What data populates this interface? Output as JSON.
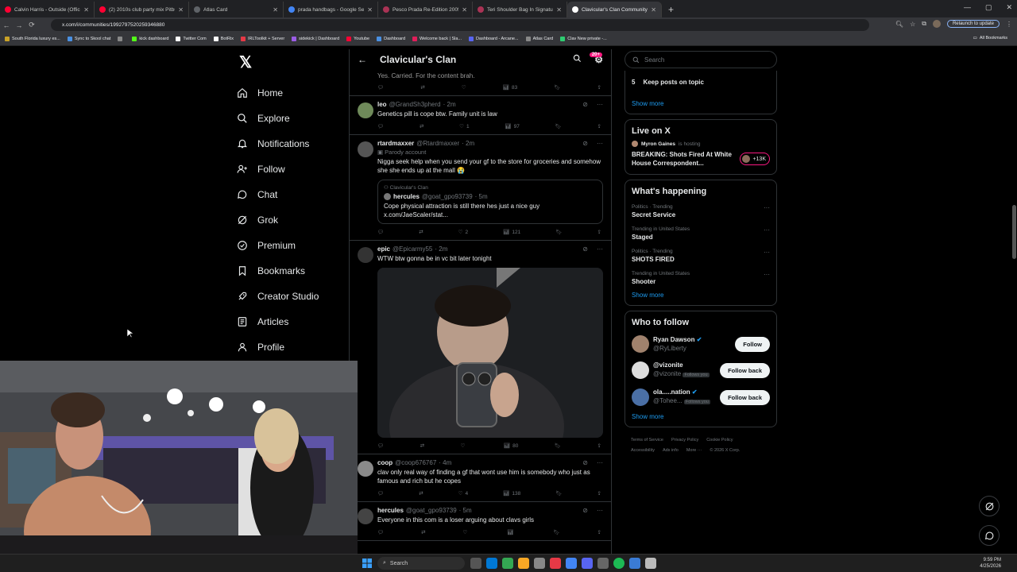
{
  "browser": {
    "tabs": [
      {
        "title": "Calvin Harris - Outside (Official",
        "color": "#ff0033",
        "active": false
      },
      {
        "title": "(2) 2010s club party mix Pitbull",
        "color": "#ff0033",
        "active": false
      },
      {
        "title": "Atlas Card",
        "color": "#5f6368",
        "active": false
      },
      {
        "title": "prada handbags - Google Search",
        "color": "#4285f4",
        "active": false
      },
      {
        "title": "Pesco Prada Re-Edition 2005 R",
        "color": "#aa3355",
        "active": false
      },
      {
        "title": "Teri Shoulder Bag In Signature",
        "color": "#aa3355",
        "active": false
      },
      {
        "title": "Clavicular's Clan Community / X",
        "color": "#ffffff",
        "active": true
      }
    ],
    "url": "x.com/i/communities/1992797520259346880",
    "relaunch_label": "Relaunch to update",
    "bookmarks": [
      {
        "label": "South Florida luxury es...",
        "color": "#c9a227"
      },
      {
        "label": "Sync to Skool chat",
        "color": "#4a90e2"
      },
      {
        "label": "",
        "color": "#888888"
      },
      {
        "label": "kick dashboard",
        "color": "#53fc18"
      },
      {
        "label": "Twitter Com",
        "color": "#ffffff"
      },
      {
        "label": "BotRix",
        "color": "#ffffff"
      },
      {
        "label": "IRLToolkit + Server",
        "color": "#e63946"
      },
      {
        "label": "sidekick | Dashboard",
        "color": "#9b5de5"
      },
      {
        "label": "Youtube",
        "color": "#ff0033"
      },
      {
        "label": "Dashboard",
        "color": "#4a90e2"
      },
      {
        "label": "Welcome back | Sla...",
        "color": "#e01e5a"
      },
      {
        "label": "Dashboard - Arcane...",
        "color": "#5865f2"
      },
      {
        "label": "Atlas Card",
        "color": "#888888"
      },
      {
        "label": "Clav New private -...",
        "color": "#2ecc71"
      }
    ],
    "all_bookmarks": "All Bookmarks"
  },
  "nav": {
    "logo": "𝕏",
    "items": [
      {
        "label": "Home",
        "icon": "home-icon"
      },
      {
        "label": "Explore",
        "icon": "search-icon"
      },
      {
        "label": "Notifications",
        "icon": "bell-icon"
      },
      {
        "label": "Follow",
        "icon": "add-person-icon"
      },
      {
        "label": "Chat",
        "icon": "chat-icon"
      },
      {
        "label": "Grok",
        "icon": "grok-icon"
      },
      {
        "label": "Premium",
        "icon": "premium-icon"
      },
      {
        "label": "Bookmarks",
        "icon": "bookmark-icon"
      },
      {
        "label": "Creator Studio",
        "icon": "rocket-icon"
      },
      {
        "label": "Articles",
        "icon": "article-icon"
      },
      {
        "label": "Profile",
        "icon": "person-icon"
      }
    ]
  },
  "feed": {
    "title": "Clavicular's Clan",
    "badge": "20+",
    "top_partial": {
      "text": "Yes. Carried. For the content brah.",
      "views": "83"
    },
    "tweets": [
      {
        "name": "leo",
        "handle": "@GrandSh3pherd",
        "time": "· 2m",
        "text": "Genetics pill is cope btw. Family unit is law",
        "likes": "1",
        "views": "97",
        "avatar": "#6f8a5a"
      },
      {
        "name": "rtardmaxxer",
        "handle": "@Rtardmaxxer",
        "time": "· 2m",
        "parody": "Parody account",
        "text": "Nigga seek help when you send your gf to the store for groceries and somehow she she ends up at the mall 😭",
        "quote": {
          "community": "Clavicular's Clan",
          "name": "hercules",
          "handle": "@goat_gpo93739",
          "time": "· 5m",
          "text": "Cope physical attraction is still there hes just a nice guy x.com/JaeScaler/stat..."
        },
        "likes": "2",
        "views": "121",
        "avatar": "#555555"
      },
      {
        "name": "epic",
        "handle": "@Epicarmy55",
        "time": "· 2m",
        "text": "WTW btw gonna be in vc bit later tonight",
        "has_media": true,
        "likes": "",
        "views": "80",
        "avatar": "#333333"
      },
      {
        "name": "coop",
        "handle": "@coop676767",
        "time": "· 4m",
        "text": "clav only real way of finding a gf that wont use him is somebody who just as famous and rich but he copes",
        "likes": "4",
        "views": "138",
        "avatar": "#8a8a8a"
      },
      {
        "name": "hercules",
        "handle": "@goat_gpo93739",
        "time": "· 5m",
        "text": "Everyone in this com is a loser arguing about clavs girls",
        "likes": "",
        "views": "",
        "avatar": "#444444"
      }
    ]
  },
  "sidebar": {
    "search_placeholder": "Search",
    "rules": {
      "number": "5",
      "rule": "Keep posts on topic",
      "show_more": "Show more"
    },
    "live": {
      "title": "Live on X",
      "host": "Myron Gaines",
      "host_suffix": "is hosting",
      "headline": "BREAKING: Shots Fired At White House Correspondent...",
      "count": "+13K"
    },
    "happening": {
      "title": "What's happening",
      "trends": [
        {
          "category": "Politics · Trending",
          "name": "Secret Service"
        },
        {
          "category": "Trending in United States",
          "name": "Staged"
        },
        {
          "category": "Politics · Trending",
          "name": "SHOTS FIRED"
        },
        {
          "category": "Trending in United States",
          "name": "Shooter"
        }
      ],
      "show_more": "Show more"
    },
    "who_to_follow": {
      "title": "Who to follow",
      "accounts": [
        {
          "name": "Ryan Dawson",
          "handle": "@RyLiberty",
          "verified": true,
          "follows_you": false,
          "button": "Follow",
          "color": "#a0826d"
        },
        {
          "name": "@vizonite",
          "handle": "@vizonite",
          "verified": false,
          "follows_you": true,
          "button": "Follow back",
          "color": "#dddddd"
        },
        {
          "name": "ola.....nation",
          "handle": "@Tohee...",
          "verified": true,
          "follows_you": true,
          "button": "Follow back",
          "color": "#4a6fa5"
        }
      ],
      "follows_you_label": "Follows you",
      "show_more": "Show more"
    },
    "footer": [
      "Terms of Service",
      "Privacy Policy",
      "Cookie Policy",
      "Accessibility",
      "Ads info",
      "More ···",
      "© 2026 X Corp."
    ]
  },
  "taskbar": {
    "search": "Search",
    "time": "9:59 PM",
    "date": "4/25/2026"
  }
}
